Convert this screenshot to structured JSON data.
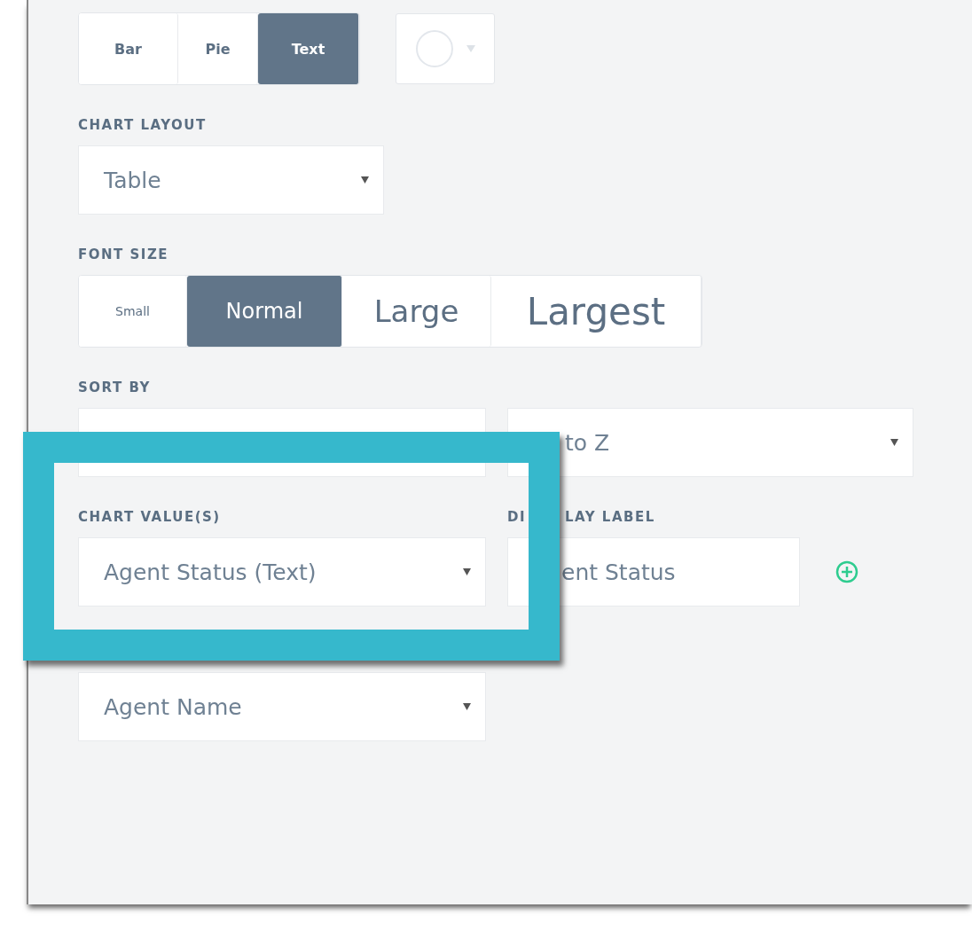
{
  "chart_types": [
    {
      "label": "Bar",
      "selected": false
    },
    {
      "label": "Pie",
      "selected": false
    },
    {
      "label": "Text",
      "selected": true
    }
  ],
  "chart_layout": {
    "label": "CHART LAYOUT",
    "value": "Table"
  },
  "font_size": {
    "label": "FONT SIZE",
    "options": [
      {
        "label": "Small",
        "kind": "small",
        "selected": false
      },
      {
        "label": "Normal",
        "kind": "normal",
        "selected": true
      },
      {
        "label": "Large",
        "kind": "large",
        "selected": false
      },
      {
        "label": "Largest",
        "kind": "largest",
        "selected": false
      }
    ]
  },
  "sort_by": {
    "label": "SORT BY",
    "order_value": "to Z"
  },
  "chart_values": {
    "label": "CHART VALUE(S)",
    "value": "Agent Status (Text)"
  },
  "display_label": {
    "label_parts": [
      "DI",
      "LAY LABEL"
    ],
    "value": "ent Status"
  },
  "group_by": {
    "value": "Agent Name"
  }
}
